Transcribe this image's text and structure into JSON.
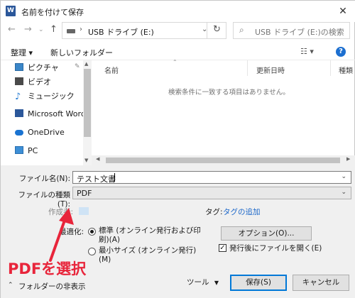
{
  "window": {
    "title": "名前を付けて保存",
    "app_icon_letter": "W",
    "close_icon": "close-icon"
  },
  "nav": {
    "address": "USB ドライブ (E:)",
    "search_placeholder": "USB ドライブ (E:)の検索"
  },
  "toolbar": {
    "organize": "整理 ▾",
    "new_folder": "新しいフォルダー",
    "view_glyph": "☷ ▾",
    "help": "?"
  },
  "sidebar": {
    "items": [
      {
        "label": "ピクチャ",
        "icon": "pictures-icon"
      },
      {
        "label": "ビデオ",
        "icon": "video-icon"
      },
      {
        "label": "ミュージック",
        "icon": "music-icon"
      },
      {
        "label": "Microsoft Word",
        "icon": "word-icon"
      },
      {
        "label": "OneDrive",
        "icon": "onedrive-icon"
      },
      {
        "label": "PC",
        "icon": "pc-icon"
      }
    ]
  },
  "filelist": {
    "col_name": "名前",
    "col_modified": "更新日時",
    "col_type": "種類",
    "empty_message": "検索条件に一致する項目はありません。"
  },
  "form": {
    "filename_label": "ファイル名(N):",
    "filename_value": "テスト文書",
    "filetype_label": "ファイルの種類(T):",
    "filetype_value": "PDF",
    "author_label": "作成者:",
    "tags_label": "タグ:",
    "tags_link": "タグの追加",
    "optimize_label": "最適化:",
    "optimize_standard": "標準 (オンライン発行および印刷)(A)",
    "optimize_minimum": "最小サイズ (オンライン発行)(M)",
    "options_button": "オプション(O)...",
    "open_after_label": "発行後にファイルを開く(E)",
    "open_after_checked": true,
    "hide_folders": "フォルダーの非表示",
    "tools_button": "ツール",
    "save_button": "保存(S)",
    "cancel_button": "キャンセル"
  },
  "annotation": {
    "text": "PDFを選択",
    "color": "#e8253b"
  }
}
